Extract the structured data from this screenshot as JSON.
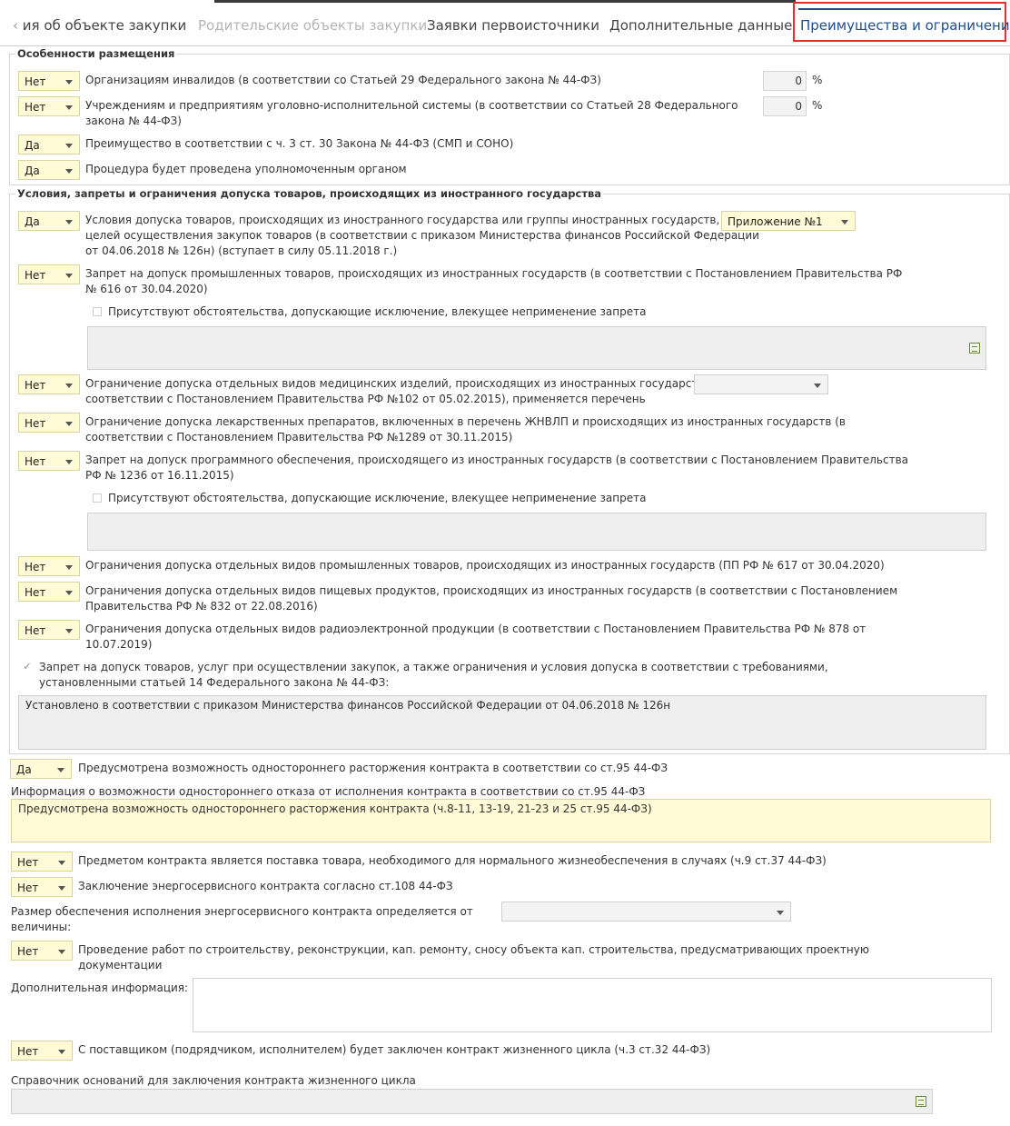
{
  "tabs": {
    "t1": "ия об объекте закупки",
    "t2": "Родительские объекты закупки",
    "t3": "Заявки первоисточники",
    "t4": "Дополнительные данные",
    "t5": "Преимущества и ограничения"
  },
  "s1": {
    "title": "Особенности размещения",
    "r1": {
      "value": "Нет",
      "label": "Организациям инвалидов (в соответствии со Статьей 29 Федерального закона № 44-ФЗ)",
      "percent": "0",
      "unit": "%"
    },
    "r2": {
      "value": "Нет",
      "label1": "Учреждениям и предприятиям уголовно-исполнительной системы (в соответствии со Статьей 28 Федерального",
      "label2": "закона № 44-ФЗ)",
      "percent": "0",
      "unit": "%"
    },
    "r3": {
      "value": "Да",
      "label": "Преимущество в соответствии с ч. 3 ст. 30 Закона № 44-ФЗ (СМП и СОНО)"
    },
    "r4": {
      "value": "Да",
      "label": "Процедура будет проведена уполномоченным органом"
    }
  },
  "s2": {
    "title": "Условия, запреты и ограничения допуска товаров, происходящих из иностранного государства",
    "r1": {
      "value": "Да",
      "l1": "Условия допуска товаров, происходящих из иностранного государства или группы иностранных государств, для",
      "l2": "целей осуществления закупок товаров (в соответствии с приказом Министерства финансов Российской Федерации",
      "l3": "от 04.06.2018 № 126н) (вступает в силу 05.11.2018 г.)",
      "select": "Приложение №1"
    },
    "r2": {
      "value": "Нет",
      "l1": "Запрет на допуск промышленных товаров, происходящих из иностранных государств (в соответствии с Постановлением Правительства РФ",
      "l2": "№ 616 от 30.04.2020)",
      "cb": "Присутствуют обстоятельства, допускающие исключение, влекущее неприменение запрета"
    },
    "r3": {
      "value": "Нет",
      "l1": "Ограничение допуска отдельных видов медицинских изделий, происходящих из иностранных государств (в",
      "l2": "соответствии с Постановлением Правительства РФ №102 от 05.02.2015), применяется перечень"
    },
    "r4": {
      "value": "Нет",
      "l1": "Ограничение допуска лекарственных препаратов, включенных в перечень ЖНВЛП и происходящих из иностранных государств (в",
      "l2": "соответствии с Постановлением Правительства РФ №1289 от 30.11.2015)"
    },
    "r5": {
      "value": "Нет",
      "l1": "Запрет на допуск программного обеспечения, происходящего из иностранных государств (в соответствии с Постановлением Правительства",
      "l2": "РФ № 1236 от 16.11.2015)",
      "cb": "Присутствуют обстоятельства, допускающие исключение, влекущее неприменение запрета"
    },
    "r6": {
      "value": "Нет",
      "l1": "Ограничения допуска отдельных видов промышленных товаров, происходящих из иностранных государств (ПП РФ № 617 от 30.04.2020)"
    },
    "r7": {
      "value": "Нет",
      "l1": "Ограничения допуска отдельных видов пищевых продуктов, происходящих из иностранных государств (в соответствии с Постановлением",
      "l2": "Правительства РФ № 832 от 22.08.2016)"
    },
    "r8": {
      "value": "Нет",
      "l1": "Ограничения допуска отдельных видов радиоэлектронной продукции (в соответствии с Постановлением Правительства РФ № 878 от",
      "l2": "10.07.2019)"
    },
    "ban": {
      "l1": "Запрет на допуск товаров, услуг при осуществлении закупок, а также ограничения и условия допуска в соответствии с требованиями,",
      "l2": "установленными статьей 14 Федерального закона № 44-ФЗ:",
      "text": "Установлено в соответствии с приказом Министерства финансов Российской Федерации от 04.06.2018 № 126н"
    }
  },
  "bottom": {
    "r1": {
      "value": "Да",
      "label": "Предусмотрена возможность одностороннего расторжения контракта в соответствии со ст.95 44-ФЗ"
    },
    "info_label": "Информация о возможности одностороннего отказа от исполнения контракта в соответствии со ст.95 44-ФЗ",
    "info_text": "Предусмотрена возможность одностороннего расторжения контракта (ч.8-11, 13-19, 21-23 и 25 ст.95 44-ФЗ)",
    "r2": {
      "value": "Нет",
      "label": "Предметом контракта является поставка товара, необходимого для нормального жизнеобеспечения в случаях (ч.9 ст.37 44-ФЗ)"
    },
    "r3": {
      "value": "Нет",
      "label": "Заключение энергосервисного контракта согласно ст.108 44-ФЗ"
    },
    "size_l1": "Размер обеспечения исполнения энергосервисного контракта определяется от",
    "size_l2": "величины:",
    "r4": {
      "value": "Нет",
      "l1": "Проведение работ по строительству, реконструкции, кап. ремонту, сносу объекта кап. строительства, предусматривающих проектную",
      "l2": "документации"
    },
    "addinfo_label": "Дополнительная информация:",
    "r5": {
      "value": "Нет",
      "label": "С поставщиком (подрядчиком, исполнителем) будет заключен контракт жизненного цикла (ч.3 ст.32 44-ФЗ)"
    },
    "lifecycle_label": "Справочник оснований для заключения контракта жизненного цикла"
  }
}
